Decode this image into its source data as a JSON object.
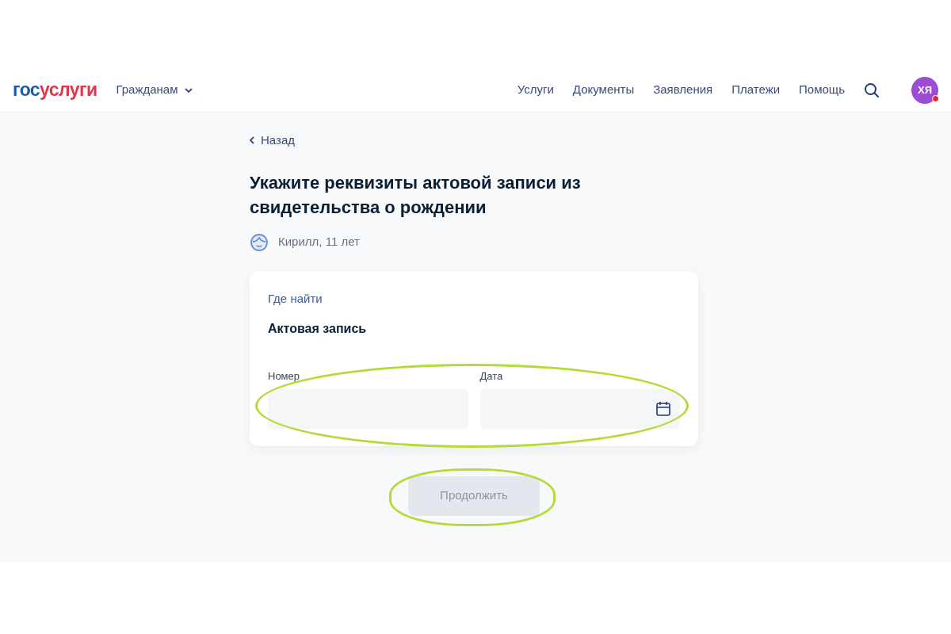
{
  "header": {
    "logo": [
      "гос",
      "услуги"
    ],
    "audience": "Гражданам",
    "nav": [
      "Услуги",
      "Документы",
      "Заявления",
      "Платежи",
      "Помощь"
    ],
    "avatar": {
      "initials": "ХЯ",
      "notification": true
    }
  },
  "back_link": "Назад",
  "title": "Укажите реквизиты актовой записи из свидетельства о рождении",
  "person": "Кирилл, 11 лет",
  "card": {
    "link": "Где найти",
    "section_title": "Актовая запись",
    "highlighted": true,
    "fields": [
      {
        "kind": "text",
        "label": "Номер"
      },
      {
        "kind": "date",
        "label": "Дата"
      }
    ]
  },
  "continue_button": {
    "label": "Продолжить",
    "disabled": true,
    "highlighted": true
  }
}
